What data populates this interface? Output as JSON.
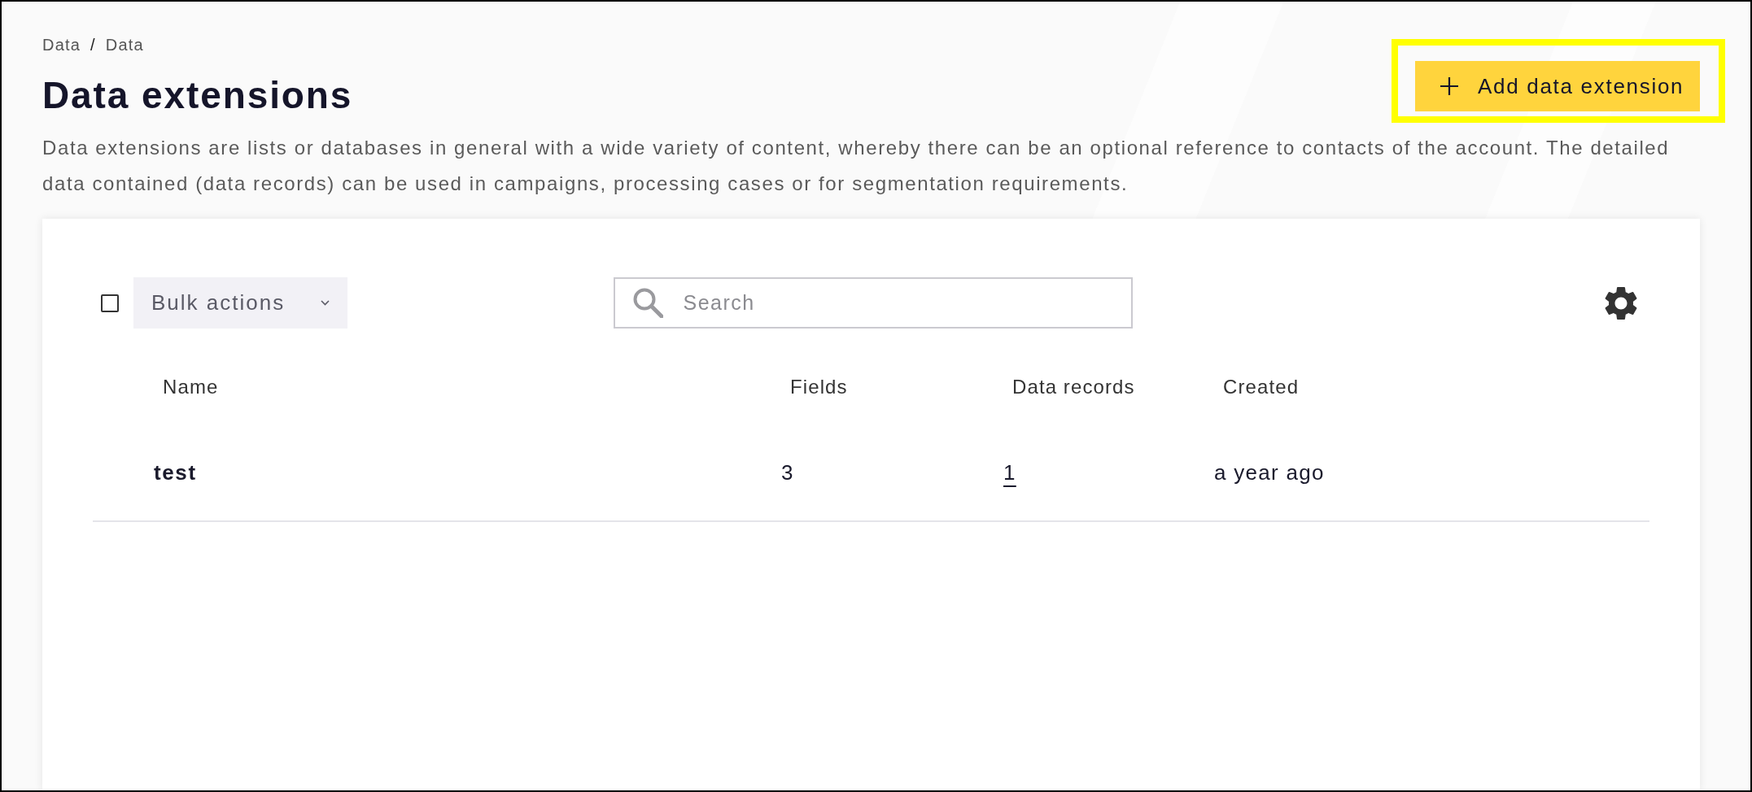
{
  "breadcrumb": {
    "items": [
      "Data",
      "Data"
    ],
    "separator": "/"
  },
  "title": "Data extensions",
  "add_button": {
    "label": "Add data extension",
    "highlighted": true
  },
  "description": "Data extensions are lists or databases in general with a wide variety of content, whereby there can be an optional reference to contacts of the account. The detailed data contained (data records) can be used in campaigns, processing cases or for segmentation requirements.",
  "toolbar": {
    "select_all": {
      "checked": false
    },
    "bulk_actions": {
      "label": "Bulk actions"
    },
    "search": {
      "placeholder": "Search"
    }
  },
  "table": {
    "columns": [
      "Name",
      "Fields",
      "Data records",
      "Created"
    ],
    "rows": [
      {
        "name": "test",
        "fields": "3",
        "data_records": "1",
        "created": "a year ago"
      }
    ]
  }
}
